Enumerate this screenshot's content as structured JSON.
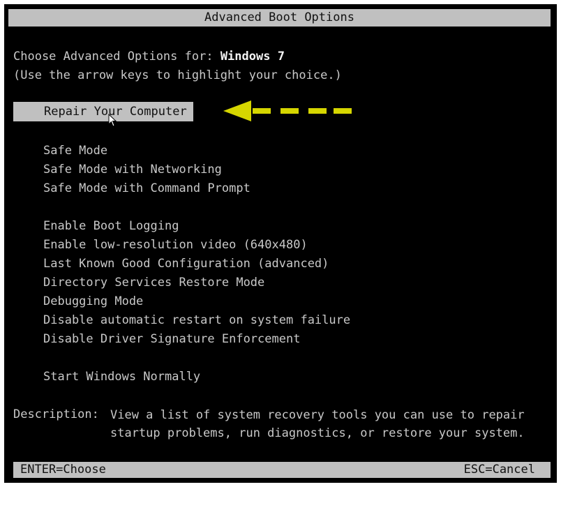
{
  "title": "Advanced Boot Options",
  "header": {
    "prefix": "Choose Advanced Options for: ",
    "os_name": "Windows 7",
    "hint": "(Use the arrow keys to highlight your choice.)"
  },
  "selected_item": "Repair Your Computer",
  "groups": {
    "safe_mode": [
      "Safe Mode",
      "Safe Mode with Networking",
      "Safe Mode with Command Prompt"
    ],
    "advanced": [
      "Enable Boot Logging",
      "Enable low-resolution video (640x480)",
      "Last Known Good Configuration (advanced)",
      "Directory Services Restore Mode",
      "Debugging Mode",
      "Disable automatic restart on system failure",
      "Disable Driver Signature Enforcement"
    ],
    "normal": [
      "Start Windows Normally"
    ]
  },
  "description": {
    "label": "Description:",
    "line1": "View a list of system recovery tools you can use to repair",
    "line2": "startup problems, run diagnostics, or restore your system."
  },
  "footer": {
    "left": "ENTER=Choose",
    "right": "ESC=Cancel"
  },
  "colors": {
    "background": "#000000",
    "text": "#c9c9c9",
    "highlight": "#c0c0c0",
    "arrow": "#d6d600"
  },
  "icons": {
    "arrow": "left-arrow-dashed-icon",
    "cursor": "mouse-pointer-icon"
  }
}
